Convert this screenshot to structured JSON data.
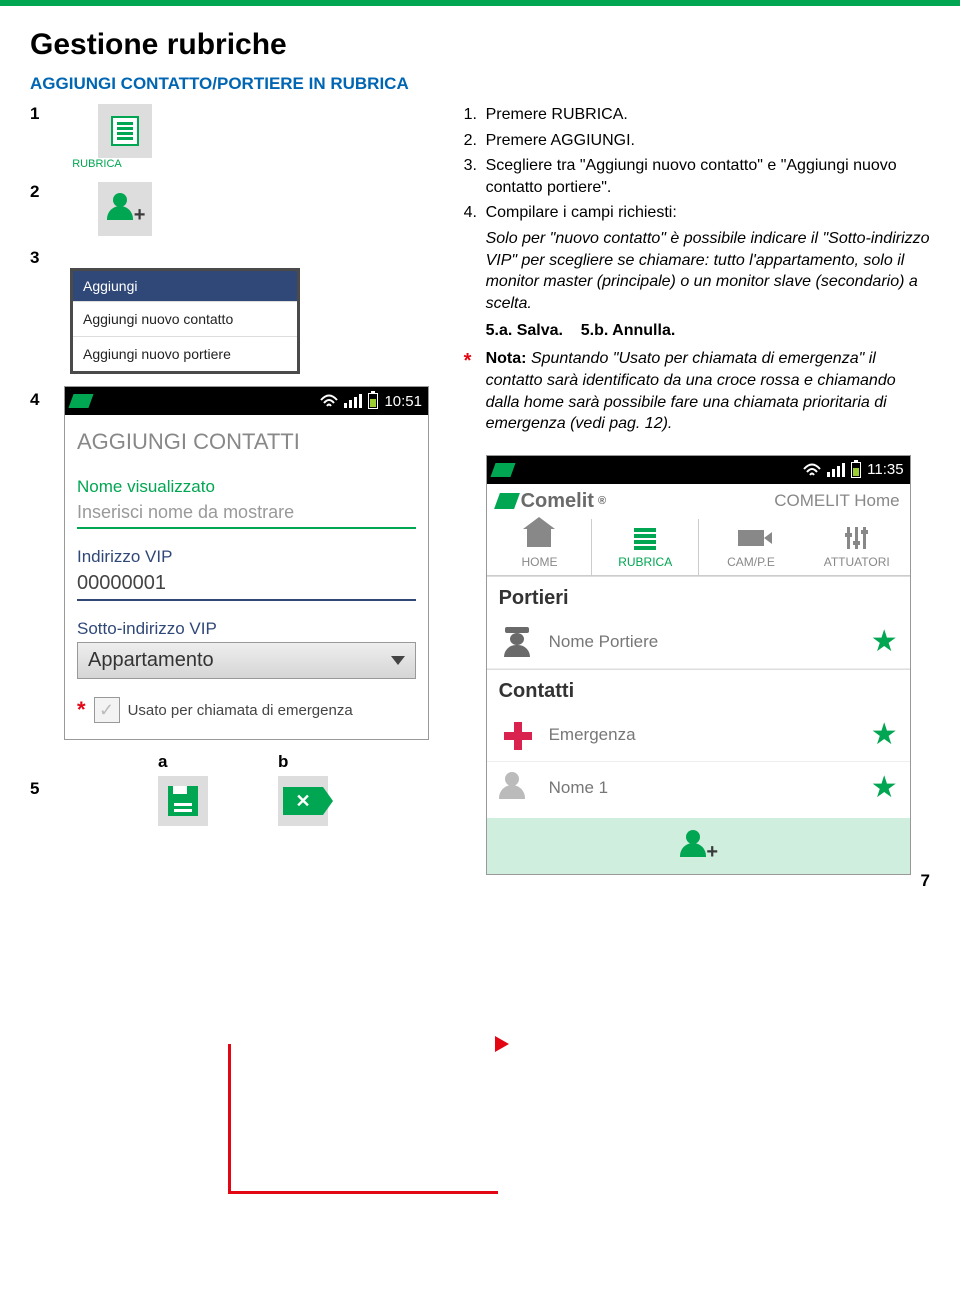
{
  "page": {
    "title": "Gestione rubriche",
    "subtitle": "AGGIUNGI CONTATTO/PORTIERE IN RUBRICA",
    "number": "7"
  },
  "markers": {
    "m1": "1",
    "m2": "2",
    "m3": "3",
    "m4": "4",
    "m5": "5",
    "a": "a",
    "b": "b",
    "star": "*"
  },
  "icon1": {
    "label": "RUBRICA"
  },
  "popup": {
    "hdr": "Aggiungi",
    "opt1": "Aggiungi nuovo contatto",
    "opt2": "Aggiungi nuovo portiere"
  },
  "status": {
    "time1": "10:51",
    "time2": "11:35"
  },
  "form": {
    "title": "AGGIUNGI CONTATTI",
    "name_label": "Nome visualizzato",
    "name_placeholder": "Inserisci nome da mostrare",
    "addr_label": "Indirizzo VIP",
    "addr_value": "00000001",
    "sub_label": "Sotto-indirizzo VIP",
    "sub_value": "Appartamento",
    "check_label": "Usato per chiamata di emergenza"
  },
  "instructions": {
    "i1": "Premere RUBRICA.",
    "i2": "Premere AGGIUNGI.",
    "i3": "Scegliere tra \"Aggiungi nuovo contatto\" e \"Aggiungi nuovo contatto portiere\".",
    "i4": "Compilare i campi richiesti:",
    "i4_note": "Solo per \"nuovo contatto\" è possibile indicare il \"Sotto-indirizzo VIP\" per scegliere se chiamare: tutto l'appartamento, solo il monitor master (principale) o un monitor slave (secondario) a scelta.",
    "i5a": "5.a. Salva.",
    "i5b": "5.b. Annulla.",
    "note_label": "Nota:",
    "note_body": "Spuntando \"Usato per chiamata di emergenza\" il contatto sarà identificato da una croce rossa e chiamando dalla home sarà possibile fare una chiamata prioritaria di emergenza (vedi pag. 12)."
  },
  "phone2": {
    "brand": "Comelit",
    "home": "COMELIT Home",
    "tab_home": "HOME",
    "tab_rubrica": "RUBRICA",
    "tab_cam": "CAM/P.E",
    "tab_att": "ATTUATORI",
    "sec_portieri": "Portieri",
    "portiere_name": "Nome Portiere",
    "sec_contatti": "Contatti",
    "emergenza": "Emergenza",
    "nome1": "Nome 1"
  }
}
